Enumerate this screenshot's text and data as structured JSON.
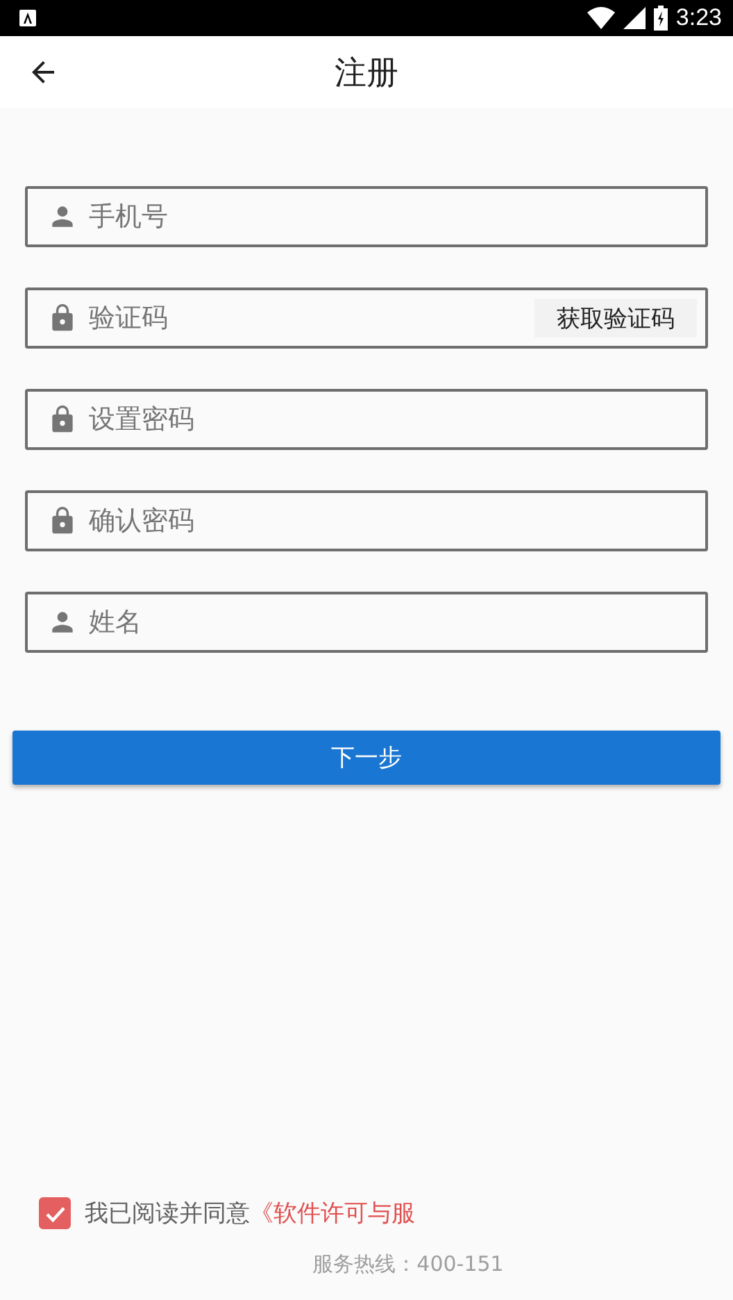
{
  "status_bar": {
    "time": "3:23"
  },
  "header": {
    "title": "注册"
  },
  "fields": [
    {
      "kind": "person",
      "placeholder": "手机号"
    },
    {
      "kind": "lock",
      "placeholder": "验证码",
      "button": "获取验证码"
    },
    {
      "kind": "lock",
      "placeholder": "设置密码"
    },
    {
      "kind": "lock",
      "placeholder": "确认密码"
    },
    {
      "kind": "person",
      "placeholder": "姓名"
    }
  ],
  "next_button": "下一步",
  "agreement": {
    "checked": true,
    "text": "我已阅读并同意",
    "link": "《软件许可与服"
  },
  "hotline": "服务热线：400-151"
}
